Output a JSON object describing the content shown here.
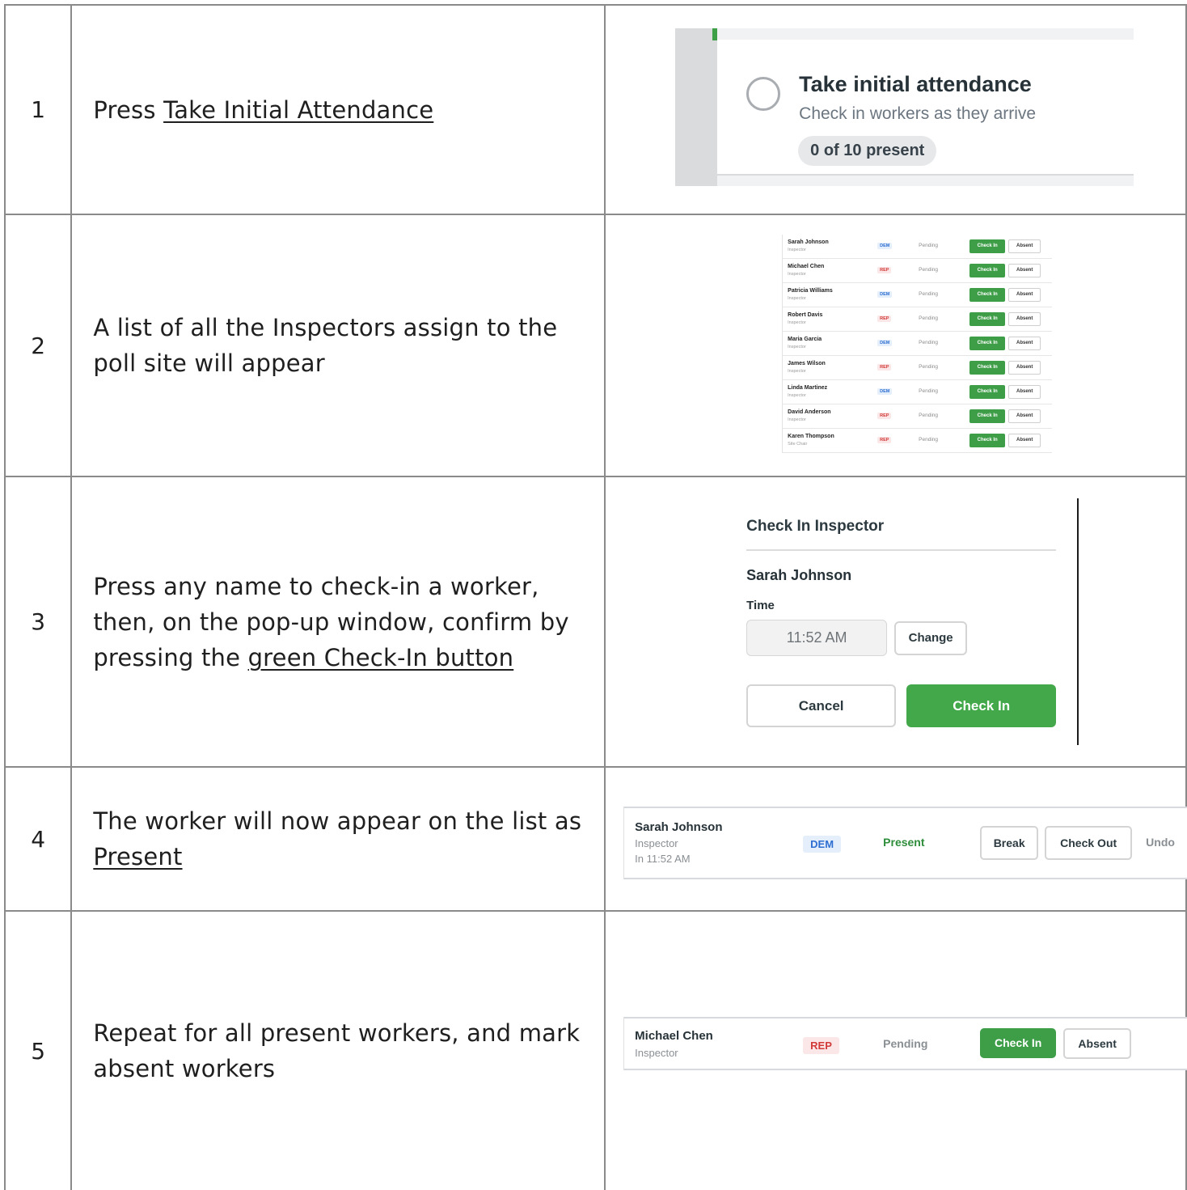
{
  "steps": [
    {
      "number": "1",
      "text_plain": "Press ",
      "text_link": "Take Initial Attendance"
    },
    {
      "number": "2",
      "text": "A list of all the Inspectors assign to the poll site will appear"
    },
    {
      "number": "3",
      "text_plain": "Press any name to check-in a worker, then, on the pop-up window, confirm by pressing the ",
      "text_link": "green Check-In button"
    },
    {
      "number": "4",
      "text_plain": "The worker will now appear on the list as ",
      "text_link": "Present"
    },
    {
      "number": "5",
      "text": "Repeat for all present workers, and mark absent workers"
    }
  ],
  "attendance_card": {
    "title": "Take initial attendance",
    "subtitle": "Check in workers as they arrive",
    "present_count": "0 of 10 present"
  },
  "roster": {
    "status": "Pending",
    "check_in_label": "Check In",
    "absent_label": "Absent",
    "rows": [
      {
        "name": "Sarah Johnson",
        "role": "Inspector",
        "party": "DEM"
      },
      {
        "name": "Michael Chen",
        "role": "Inspector",
        "party": "REP"
      },
      {
        "name": "Patricia Williams",
        "role": "Inspector",
        "party": "DEM"
      },
      {
        "name": "Robert Davis",
        "role": "Inspector",
        "party": "REP"
      },
      {
        "name": "Maria Garcia",
        "role": "Inspector",
        "party": "DEM"
      },
      {
        "name": "James Wilson",
        "role": "Inspector",
        "party": "REP"
      },
      {
        "name": "Linda Martinez",
        "role": "Inspector",
        "party": "DEM"
      },
      {
        "name": "David Anderson",
        "role": "Inspector",
        "party": "REP"
      },
      {
        "name": "Karen Thompson",
        "role": "Site Chair",
        "party": "REP"
      }
    ]
  },
  "dialog": {
    "title": "Check In Inspector",
    "worker_name": "Sarah Johnson",
    "time_label": "Time",
    "time_value": "11:52 AM",
    "change_label": "Change",
    "cancel_label": "Cancel",
    "confirm_label": "Check In"
  },
  "present_row": {
    "name": "Sarah Johnson",
    "role": "Inspector",
    "time": "In 11:52 AM",
    "party": "DEM",
    "status": "Present",
    "break_label": "Break",
    "checkout_label": "Check Out",
    "undo_label": "Undo"
  },
  "pending_row": {
    "name": "Michael Chen",
    "role": "Inspector",
    "party": "REP",
    "status": "Pending",
    "check_in_label": "Check In",
    "absent_label": "Absent"
  },
  "colors": {
    "green": "#3e9e48",
    "dem_text": "#2e6fd1",
    "dem_bg": "#e5eefb",
    "rep_text": "#d23a3a",
    "rep_bg": "#fbe7e7",
    "present": "#2e8d3b"
  }
}
